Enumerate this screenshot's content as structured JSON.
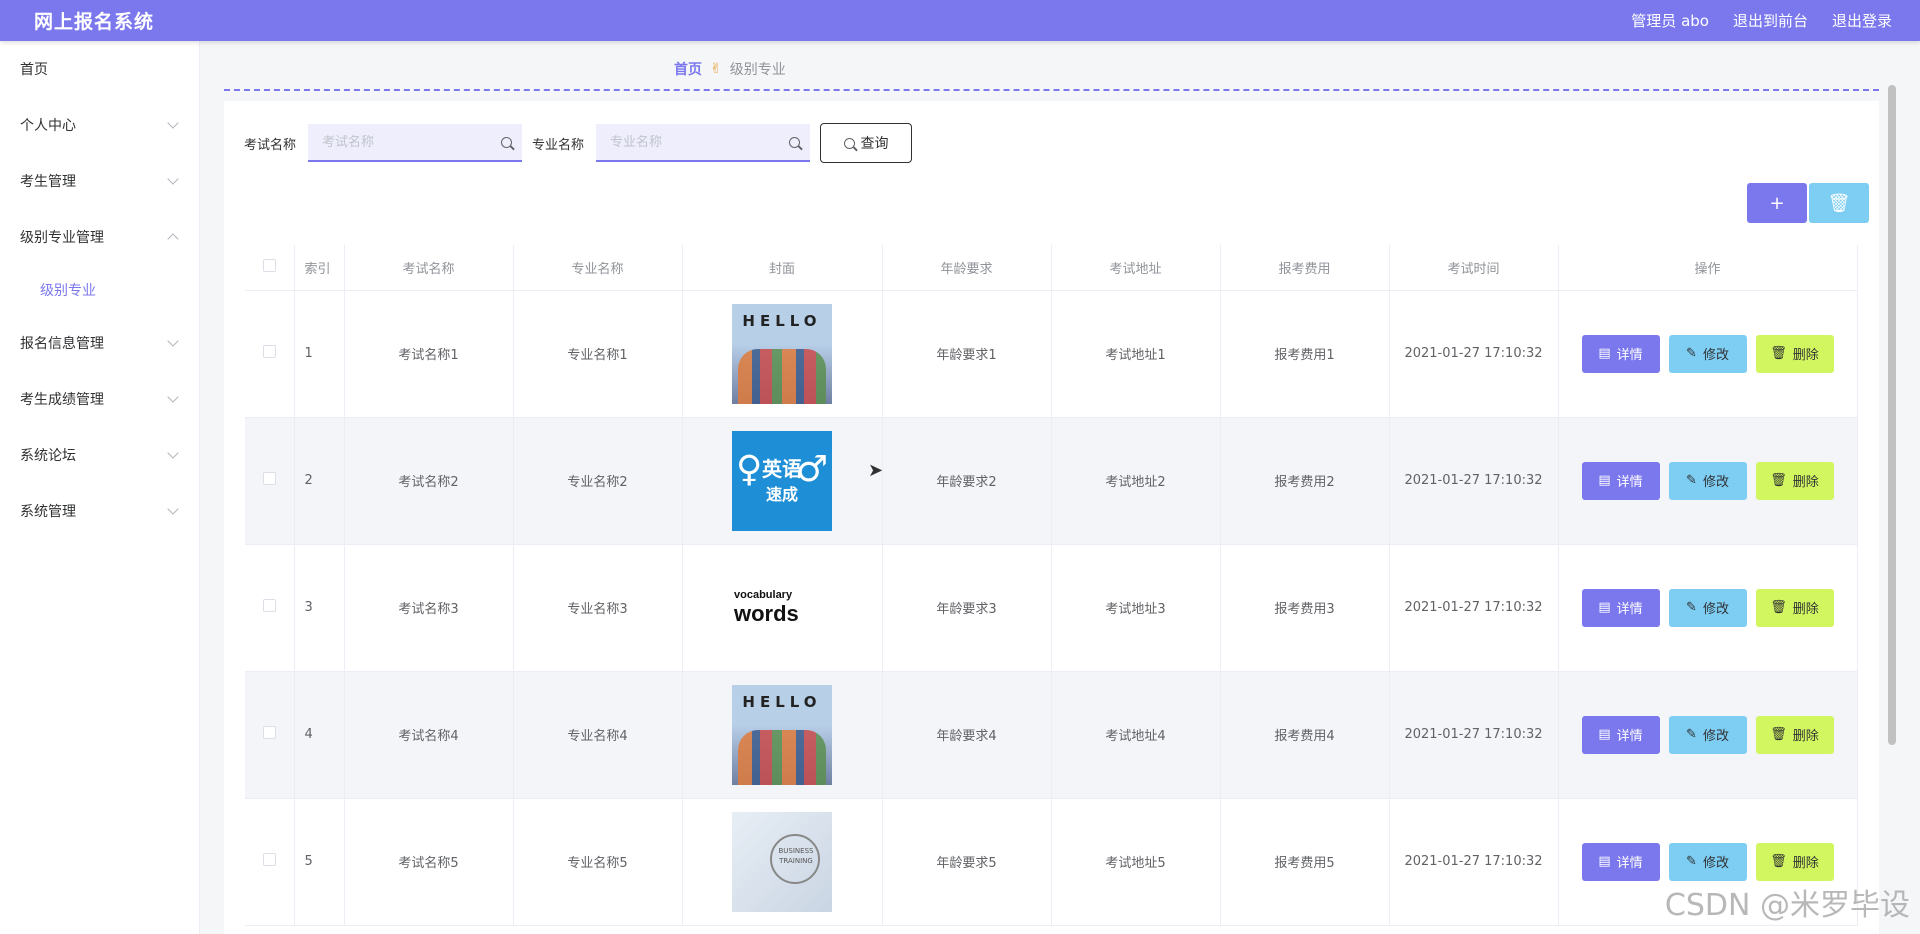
{
  "header": {
    "brand": "网上报名系统",
    "user_label": "管理员 abo",
    "to_front": "退出到前台",
    "logout": "退出登录"
  },
  "sidebar": {
    "items": [
      {
        "label": "首页",
        "expandable": false
      },
      {
        "label": "个人中心",
        "expandable": true
      },
      {
        "label": "考生管理",
        "expandable": true
      },
      {
        "label": "级别专业管理",
        "expandable": true,
        "expanded": true
      },
      {
        "label": "报名信息管理",
        "expandable": true
      },
      {
        "label": "考生成绩管理",
        "expandable": true
      },
      {
        "label": "系统论坛",
        "expandable": true
      },
      {
        "label": "系统管理",
        "expandable": true
      }
    ],
    "sub_active": "级别专业"
  },
  "breadcrumb": {
    "home": "首页",
    "current": "级别专业"
  },
  "search": {
    "exam_label": "考试名称",
    "exam_placeholder": "考试名称",
    "major_label": "专业名称",
    "major_placeholder": "专业名称",
    "query_label": "查询"
  },
  "toolbar": {
    "add": "+",
    "delete": "🗑"
  },
  "table": {
    "headers": [
      "索引",
      "考试名称",
      "专业名称",
      "封面",
      "年龄要求",
      "考试地址",
      "报考费用",
      "考试时间",
      "操作"
    ],
    "rows": [
      {
        "idx": "1",
        "exam": "考试名称1",
        "major": "专业名称1",
        "cover": "hello",
        "age": "年龄要求1",
        "addr": "考试地址1",
        "fee": "报考费用1",
        "time": "2021-01-27 17:10:32"
      },
      {
        "idx": "2",
        "exam": "考试名称2",
        "major": "专业名称2",
        "cover": "english",
        "age": "年龄要求2",
        "addr": "考试地址2",
        "fee": "报考费用2",
        "time": "2021-01-27 17:10:32"
      },
      {
        "idx": "3",
        "exam": "考试名称3",
        "major": "专业名称3",
        "cover": "words",
        "age": "年龄要求3",
        "addr": "考试地址3",
        "fee": "报考费用3",
        "time": "2021-01-27 17:10:32"
      },
      {
        "idx": "4",
        "exam": "考试名称4",
        "major": "专业名称4",
        "cover": "hello",
        "age": "年龄要求4",
        "addr": "考试地址4",
        "fee": "报考费用4",
        "time": "2021-01-27 17:10:32"
      },
      {
        "idx": "5",
        "exam": "考试名称5",
        "major": "专业名称5",
        "cover": "business",
        "age": "年龄要求5",
        "addr": "考试地址5",
        "fee": "报考费用5",
        "time": "2021-01-27 17:10:32"
      }
    ],
    "op_detail": "详情",
    "op_edit": "修改",
    "op_delete": "删除"
  },
  "cover_text": {
    "hello": "HELLO",
    "english": "英语",
    "english_sub": "速成",
    "words": "vocabulary words",
    "business": "BUSINESS TRAINING"
  },
  "watermark": "CSDN @米罗毕设",
  "colors": {
    "primary": "#7b78ee",
    "info": "#7ecdf3",
    "lime": "#d1f660"
  }
}
